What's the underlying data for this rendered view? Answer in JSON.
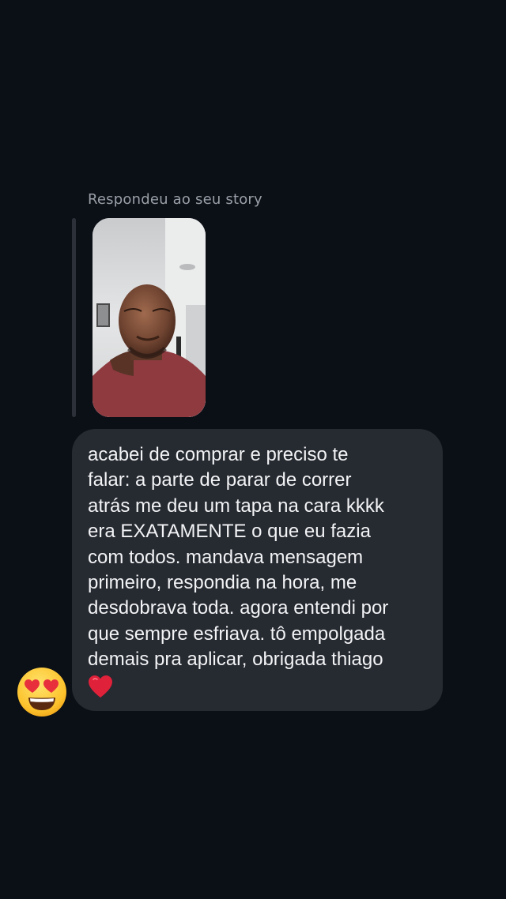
{
  "story_reply": {
    "label": "Respondeu ao seu story"
  },
  "message": {
    "text": "acabei de comprar e preciso te\nfalar: a parte de parar de correr\natrás me deu um tapa na cara kkkk\nera EXATAMENTE o que eu fazia\ncom todos. mandava mensagem\nprimeiro, respondia na hora, me\ndesdobrava toda. agora entendi por\nque sempre esfriava. tô empolgada\ndemais pra aplicar, obrigada thiago",
    "trailing_emoji": "red-heart-icon"
  },
  "reaction": {
    "emoji": "heart-eyes-face-icon"
  },
  "colors": {
    "background": "#0b0f16",
    "bubble": "#262a31",
    "label": "#9aa0a8",
    "text": "#f2f3f5",
    "heart": "#e0213a"
  }
}
